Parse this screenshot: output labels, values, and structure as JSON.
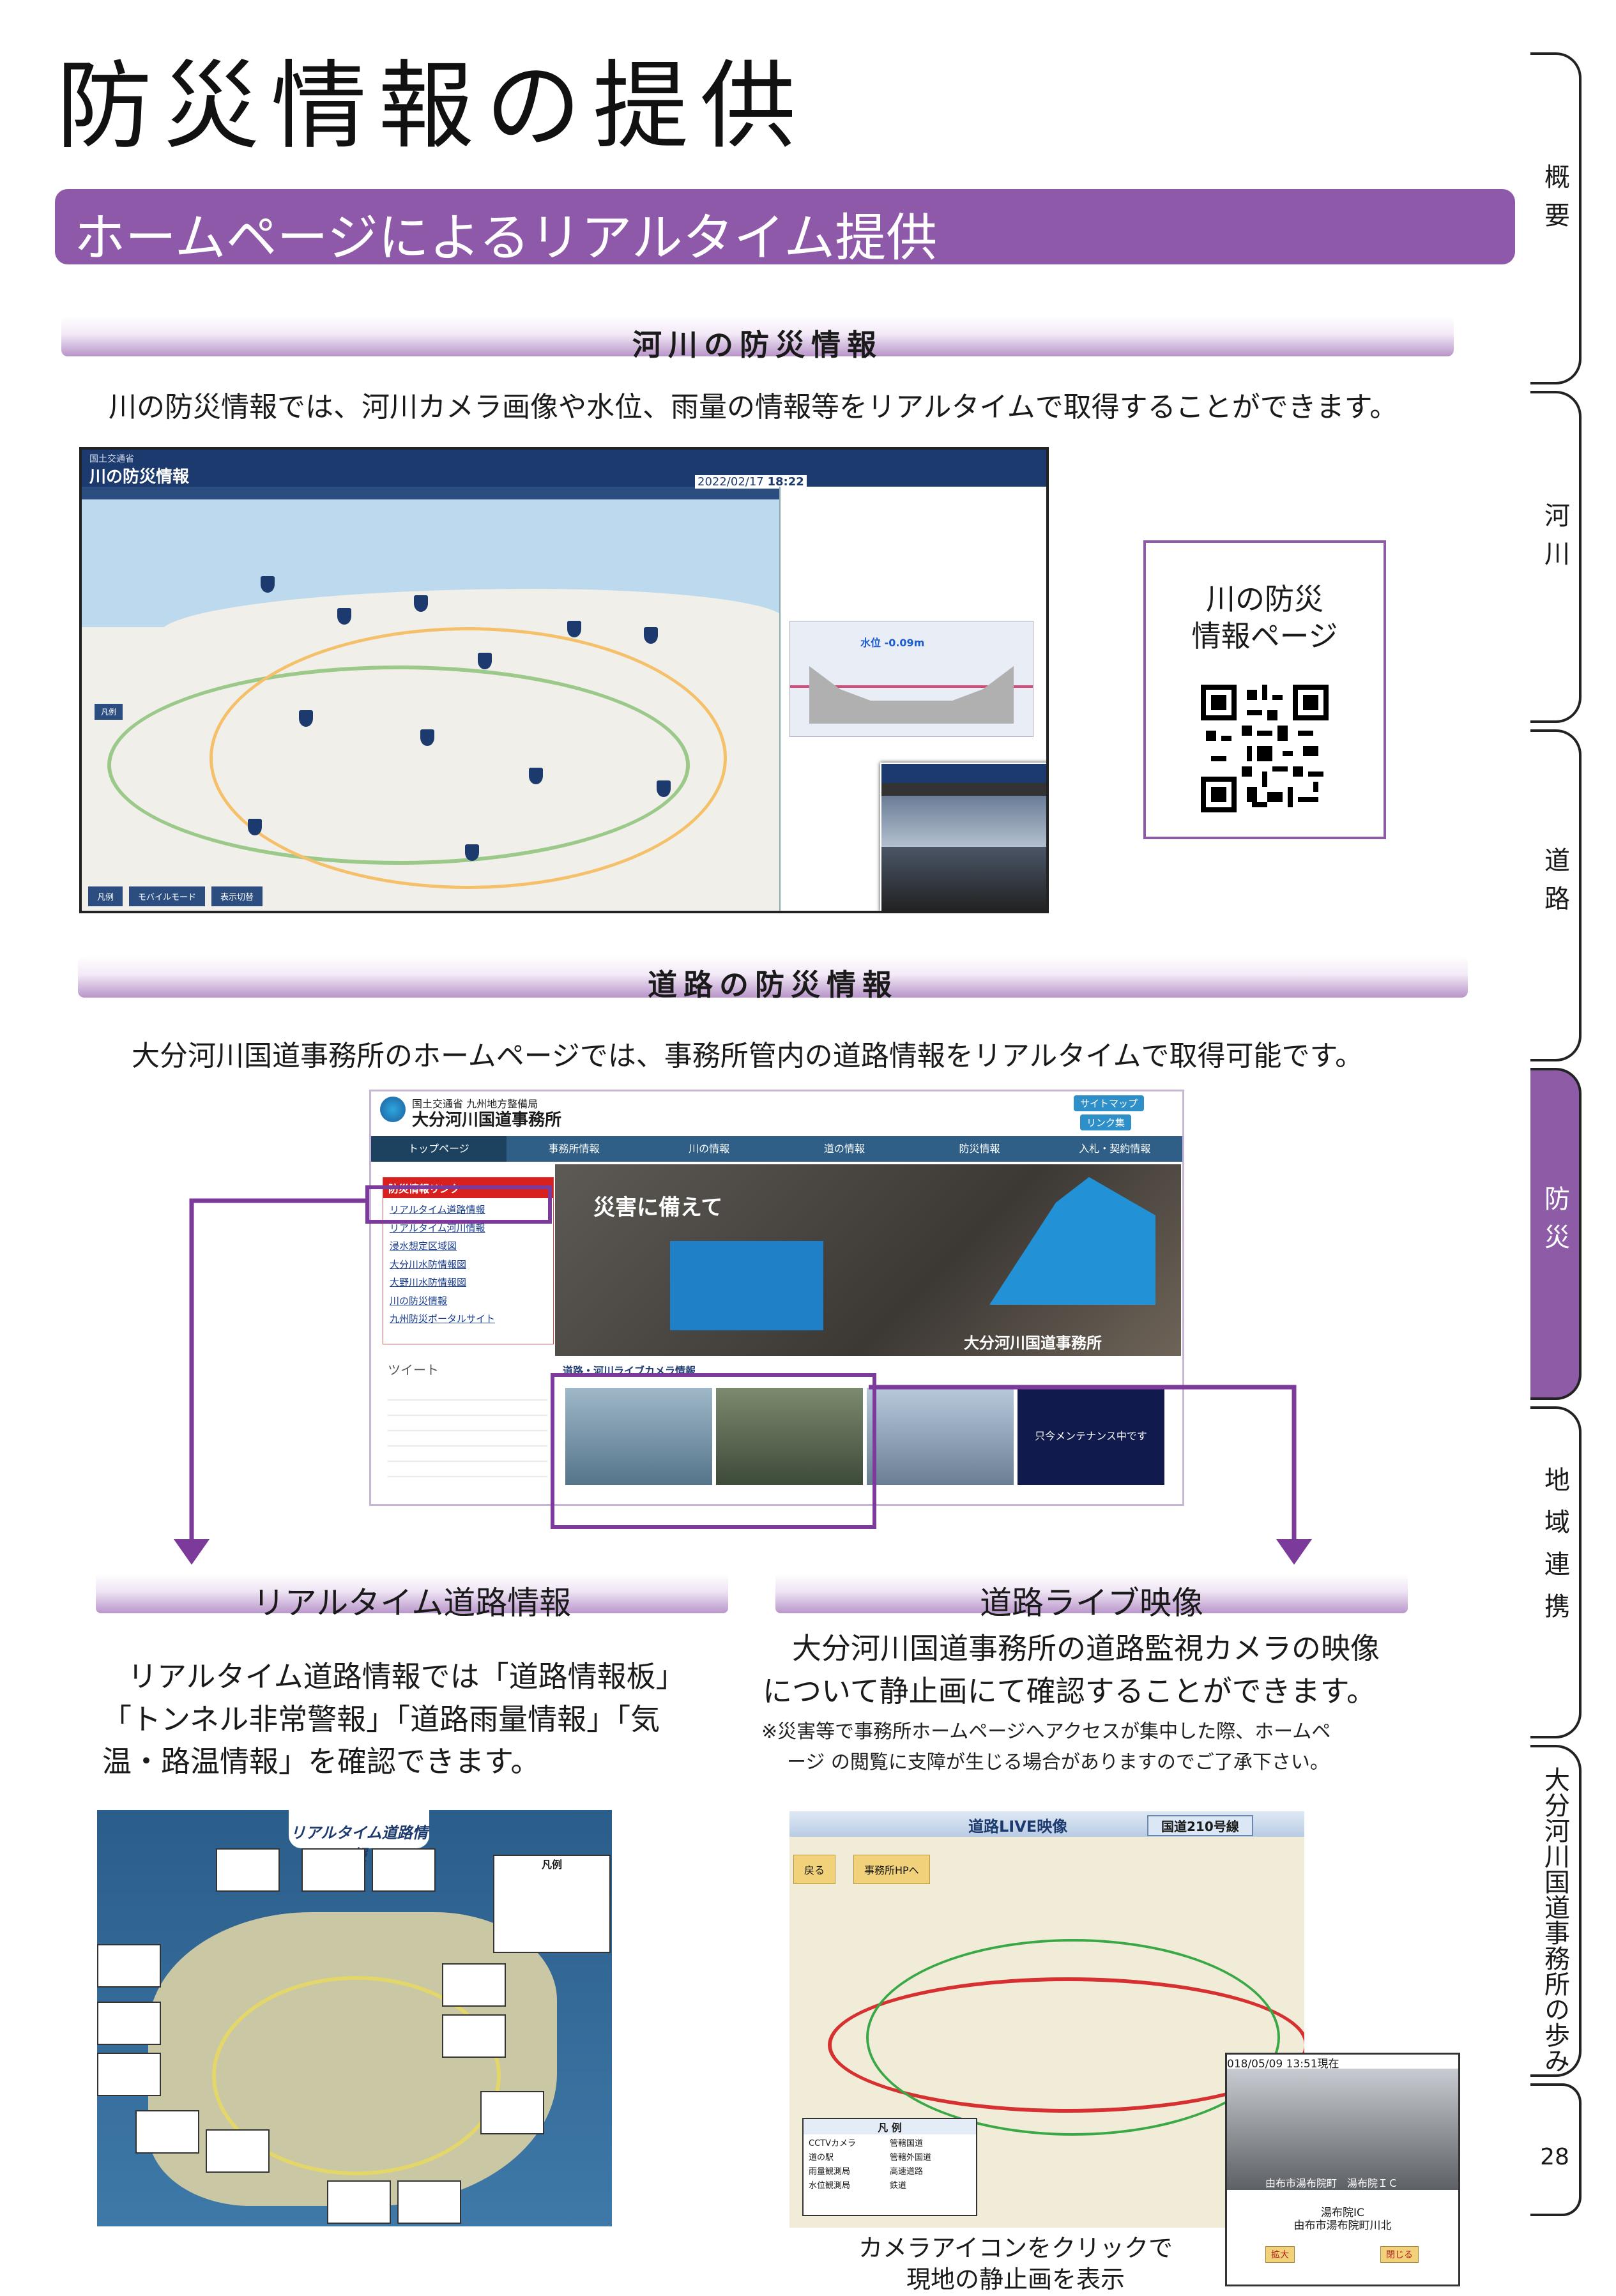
{
  "page": {
    "title": "防災情報の提供",
    "banner": "ホームページによるリアルタイム提供",
    "page_number": "28"
  },
  "river": {
    "heading": "河川の防災情報",
    "description": "川の防災情報では、河川カメラ画像や水位、雨量の情報等をリアルタイムで取得することができます。",
    "qr_label_line1": "川の防災",
    "qr_label_line2": "情報ページ",
    "screenshot": {
      "app_name": "川の防災情報",
      "ministry": "国土交通省",
      "datetime": "2022/02/17",
      "time": "18:22",
      "water_level": "水位 -0.09m",
      "buttons": [
        "凡例",
        "モバイルモード",
        "表示切替"
      ]
    }
  },
  "road": {
    "heading": "道路の防災情報",
    "description": "大分河川国道事務所のホームページでは、事務所管内の道路情報をリアルタイムで取得可能です。",
    "site": {
      "org_line": "国土交通省 九州地方整備局",
      "office_name": "大分河川国道事務所",
      "nav": [
        "トップページ",
        "事務所情報",
        "川の情報",
        "道の情報",
        "防災情報",
        "入札・契約情報"
      ],
      "sitemap": "サイトマップ",
      "links_button": "リンク集",
      "link_box_title": "防災情報リンク",
      "links": [
        "リアルタイム道路情報",
        "リアルタイム河川情報",
        "浸水想定区域図",
        "大分川水防情報図",
        "大野川水防情報図",
        "川の防災情報",
        "九州防災ポータルサイト"
      ],
      "hero_text": "災害に備えて",
      "hero_logo": "大分河川国道事務所",
      "tweets_title": "ツイート",
      "camera_title": "道路・河川ライブカメラ情報",
      "maintenance": "只今メンテナンス中です"
    },
    "realtime": {
      "title": "リアルタイム道路情報",
      "text_line1": "リアルタイム道路情報では「道路情報板」",
      "text_line2": "「トンネル非常警報」「道路雨量情報」「気",
      "text_line3": "温・路温情報」を確認できます。",
      "map_title": "リアルタイム道路情報",
      "legend_title": "凡例"
    },
    "live": {
      "title": "道路ライブ映像",
      "text_line1": "大分河川国道事務所の道路監視カメラの映像",
      "text_line2": "について静止画にて確認することができます。",
      "note_line1": "※災害等で事務所ホームページへアクセスが集中した際、ホームペ",
      "note_line2": "ージ の閲覧に支障が生じる場合がありますのでご了承下さい。",
      "map_title": "道路LIVE映像",
      "route": "国道210号線",
      "back": "戻る",
      "office_hp": "事務所HPへ",
      "legend_title": "凡 例",
      "legend_items": [
        "CCTVカメラ",
        "道の駅",
        "雨量観測局",
        "水位観測局",
        "管轄国道",
        "管轄外国道",
        "高速道路",
        "鉄道"
      ],
      "cam_timestamp": "018/05/09 13:51現在",
      "cam_place": "由布市湯布院町　湯布院ＩＣ",
      "cam_caption1": "湯布院IC",
      "cam_caption2": "由布市湯布院町川北",
      "cam_btn1": "拡大",
      "cam_btn2": "閉じる",
      "click_caption1": "カメラアイコンをクリックで",
      "click_caption2": "現地の静止画を表示"
    }
  },
  "side_tabs": [
    {
      "label": "概要",
      "active": false
    },
    {
      "label": "河川",
      "active": false
    },
    {
      "label": "道路",
      "active": false
    },
    {
      "label": "防災",
      "active": true
    },
    {
      "label": "地域連携",
      "active": false
    },
    {
      "label": "大分河川国道事務所の歩み",
      "active": false
    }
  ],
  "colors": {
    "accent": "#8e5ba6",
    "navy": "#1d3a6e",
    "site_nav": "#2f5f86"
  }
}
